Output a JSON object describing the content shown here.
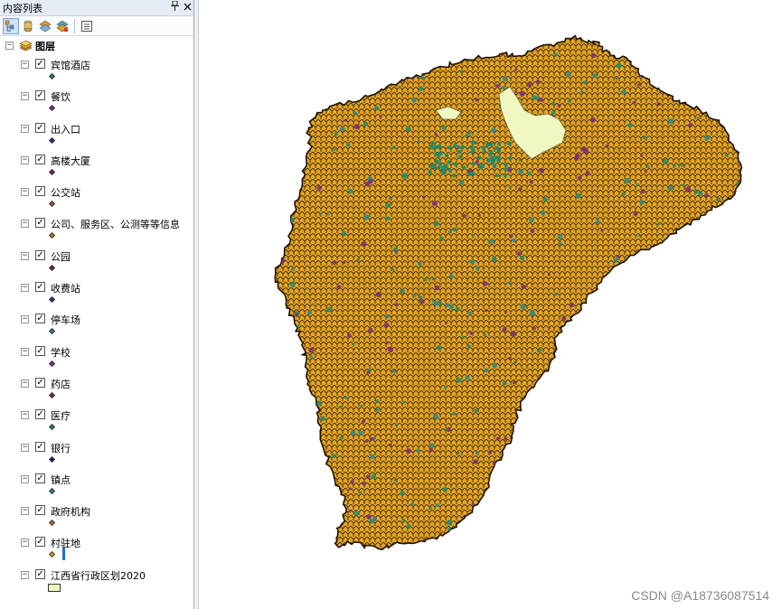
{
  "toc": {
    "title": "内容列表",
    "pin_glyph": "📌",
    "close_glyph": "✕",
    "toolbar": [
      "list-by-drawing-order-icon",
      "list-by-source-icon",
      "list-by-visibility-icon",
      "list-by-selection-icon",
      "options-icon"
    ],
    "root": {
      "label": "图层",
      "expanded": true
    },
    "layers": [
      {
        "name": "宾馆酒店",
        "checked": true,
        "color": "#1f8a6e"
      },
      {
        "name": "餐饮",
        "checked": true,
        "color": "#7a2a7a"
      },
      {
        "name": "出入口",
        "checked": true,
        "color": "#2b2b8a"
      },
      {
        "name": "高楼大厦",
        "checked": true,
        "color": "#8a1f6e"
      },
      {
        "name": "公交站",
        "checked": true,
        "color": "#b15a3a"
      },
      {
        "name": "公司、服务区、公测等等信息",
        "checked": true,
        "color": "#c07a2a"
      },
      {
        "name": "公园",
        "checked": true,
        "color": "#6a1f3a"
      },
      {
        "name": "收费站",
        "checked": true,
        "color": "#1f3a8a"
      },
      {
        "name": "停车场",
        "checked": true,
        "color": "#2a8a8a"
      },
      {
        "name": "学校",
        "checked": true,
        "color": "#8a2a9a"
      },
      {
        "name": "药店",
        "checked": true,
        "color": "#8a2a3a"
      },
      {
        "name": "医疗",
        "checked": true,
        "color": "#2a8a6a"
      },
      {
        "name": "银行",
        "checked": true,
        "color": "#1a1a7a"
      },
      {
        "name": "镇点",
        "checked": true,
        "color": "#2a8a8a"
      },
      {
        "name": "政府机构",
        "checked": true,
        "color": "#c0742a"
      },
      {
        "name": "村驻地",
        "checked": true,
        "color": "#e5a423"
      },
      {
        "name": "江西省行政区划2020",
        "checked": true,
        "color": "#f2f5c0",
        "symbol": "polygon"
      }
    ]
  },
  "map": {
    "fill_color": "#e5a423",
    "outline_color": "#2b1f08",
    "lake_color": "#f1f7c2",
    "dot_colors": [
      "#1f8a6e",
      "#7a2a7a",
      "#2a8a8a"
    ]
  },
  "watermark": "CSDN @A18736087514"
}
